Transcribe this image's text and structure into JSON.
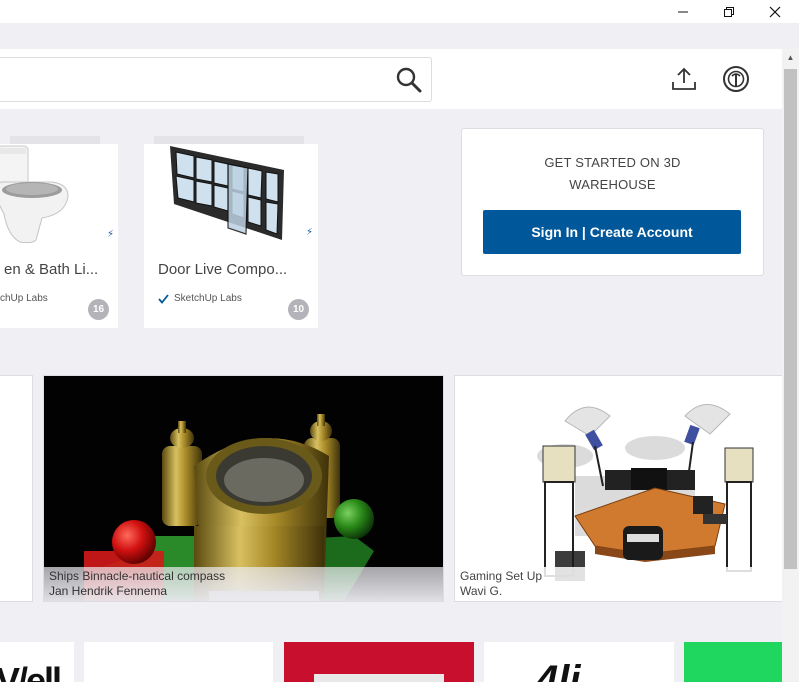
{
  "window": {
    "minimize_glyph": "—",
    "restore_glyph": "❐",
    "close_glyph": "✕"
  },
  "header": {
    "search_placeholder": "",
    "icons": [
      "search-icon",
      "upload-icon",
      "account-icon"
    ]
  },
  "cards": [
    {
      "title": "en & Bath Li...",
      "author": "chUp Labs",
      "verified": false,
      "count": "16"
    },
    {
      "title": "Door Live Compo...",
      "author": "SketchUp Labs",
      "verified": true,
      "count": "10"
    }
  ],
  "signin": {
    "heading_line1": "GET STARTED ON 3D",
    "heading_line2": "WAREHOUSE",
    "button_label": "Sign In | Create Account"
  },
  "models": [
    {
      "title": "Ships Binnacle-nautical compass",
      "author": "Jan Hendrik Fennema"
    },
    {
      "title": "Gaming Set Up",
      "author": "Wavi G."
    }
  ],
  "bottom_row": {
    "tile1_text": "V/ell",
    "tile4_text": "4li"
  },
  "colors": {
    "accent": "#00579a",
    "badge": "#b3b3b9",
    "red_tile": "#c8102e",
    "green_tile": "#1fd65f"
  }
}
